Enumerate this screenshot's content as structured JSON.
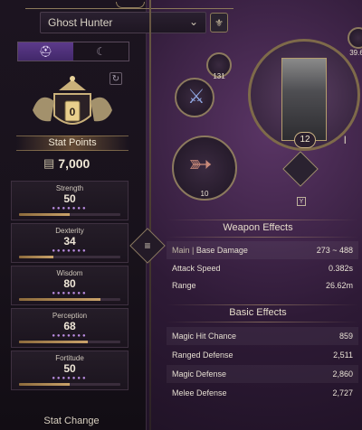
{
  "header": {
    "class_select": "Ghost Hunter",
    "chevron_icon": "chevron-down-icon",
    "mode_tabs": [
      "helmet-icon",
      "sickle-icon"
    ]
  },
  "stat_panel": {
    "crest_value": "0",
    "stat_points_label": "Stat Points",
    "currency_value": "7,000",
    "stats": [
      {
        "name": "Strength",
        "value": "50",
        "dots": "●●●●●●●",
        "fill": 0.5
      },
      {
        "name": "Dexterity",
        "value": "34",
        "dots": "●●●●●●●",
        "fill": 0.34
      },
      {
        "name": "Wisdom",
        "value": "80",
        "dots": "●●●●●●●",
        "fill": 0.8
      },
      {
        "name": "Perception",
        "value": "68",
        "dots": "●●●●●●●",
        "fill": 0.68
      },
      {
        "name": "Fortitude",
        "value": "50",
        "dots": "●●●●●●●",
        "fill": 0.5
      }
    ],
    "stat_change_label": "Stat Change"
  },
  "equipment": {
    "top_right_count": "39.6",
    "small_top_count": "131",
    "weapon_level": "12",
    "weapon_tier": "I",
    "bow_level": "10",
    "hotkey": "Y"
  },
  "weapon_effects": {
    "title": "Weapon Effects",
    "rows": [
      {
        "tag": "Main",
        "label": "Base Damage",
        "value": "273 ~ 488"
      },
      {
        "label": "Attack Speed",
        "value": "0.382s"
      },
      {
        "label": "Range",
        "value": "26.62m"
      }
    ]
  },
  "basic_effects": {
    "title": "Basic Effects",
    "rows": [
      {
        "label": "Magic Hit Chance",
        "value": "859"
      },
      {
        "label": "Ranged Defense",
        "value": "2,511"
      },
      {
        "label": "Magic Defense",
        "value": "2,860"
      },
      {
        "label": "Melee Defense",
        "value": "2,727"
      }
    ]
  },
  "colors": {
    "accent_purple": "#5c3a8a",
    "gold": "#c9a26a"
  }
}
